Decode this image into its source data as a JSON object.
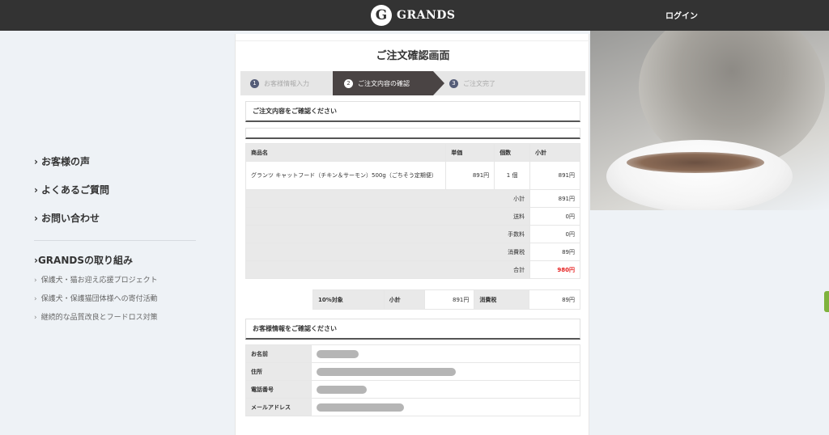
{
  "header": {
    "logo_mark": "G",
    "logo_text": "GRANDS",
    "login_label": "ログイン"
  },
  "leftnav": {
    "main_items": [
      {
        "label": "お客様の声"
      },
      {
        "label": "よくあるご質問"
      },
      {
        "label": "お問い合わせ"
      }
    ],
    "group_title": "GRANDSの取り組み",
    "sub_items": [
      {
        "label": "保護犬・猫お迎え応援プロジェクト"
      },
      {
        "label": "保護犬・保護猫団体様への寄付活動"
      },
      {
        "label": "継続的な品質改良とフードロス対策"
      }
    ]
  },
  "page": {
    "title": "ご注文確認画面",
    "steps": [
      {
        "num": "1",
        "label": "お客様情報入力"
      },
      {
        "num": "2",
        "label": "ご注文内容の確認"
      },
      {
        "num": "3",
        "label": "ご注文完了"
      }
    ],
    "order_section_title": "ご注文内容をご確認ください",
    "customer_section_title": "お客様情報をご確認ください"
  },
  "order_table": {
    "headers": {
      "name": "商品名",
      "unit_price": "単価",
      "qty": "個数",
      "subtotal": "小計"
    },
    "item": {
      "name": "グランツ キャットフード（チキン＆サーモン）500g（ごちそう定期便）",
      "unit_price": "891円",
      "qty": "1 個",
      "subtotal": "891円"
    },
    "summary": [
      {
        "label": "小計",
        "value": "891円"
      },
      {
        "label": "送料",
        "value": "0円"
      },
      {
        "label": "手数料",
        "value": "0円"
      },
      {
        "label": "消費税",
        "value": "89円"
      },
      {
        "label": "合計",
        "value": "980円"
      }
    ]
  },
  "tax_table": {
    "target": "10%対象",
    "subtotal_label": "小計",
    "subtotal_value": "891円",
    "tax_label": "消費税",
    "tax_value": "89円"
  },
  "customer": {
    "rows": [
      {
        "label": "お名前"
      },
      {
        "label": "住所"
      },
      {
        "label": "電話番号"
      },
      {
        "label": "メールアドレス"
      }
    ]
  },
  "colors": {
    "header_bg": "#333333",
    "active_step": "#4a4444",
    "step_circle": "#555d78",
    "total_red": "#e62222",
    "page_bg": "#eef2f6"
  }
}
